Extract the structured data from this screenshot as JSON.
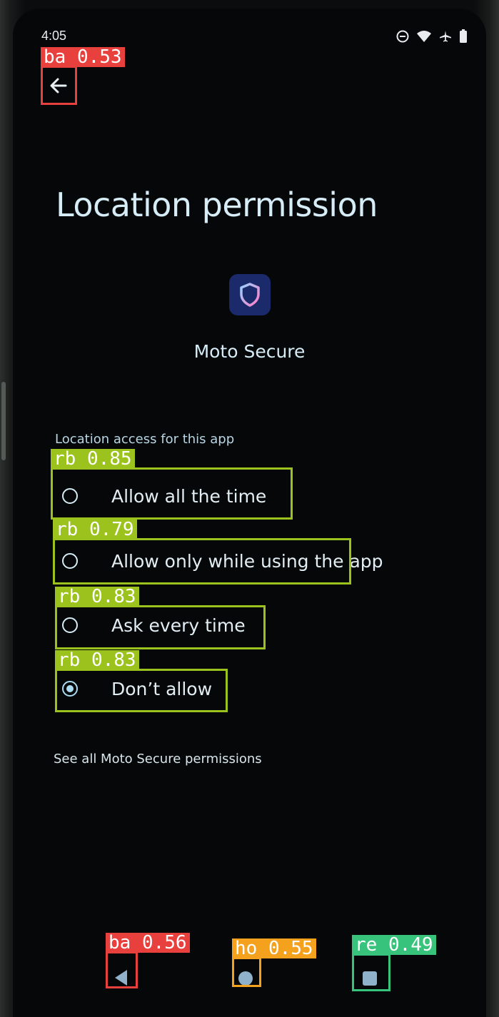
{
  "status_bar": {
    "time": "4:05",
    "icons": [
      "do-not-disturb-icon",
      "wifi-icon",
      "airplane-icon",
      "battery-icon"
    ]
  },
  "page": {
    "title": "Location permission",
    "app_icon": "moto-secure-shield-icon",
    "app_name": "Moto Secure",
    "section_label": "Location access for this app",
    "options": [
      {
        "label": "Allow all the time",
        "checked": false
      },
      {
        "label": "Allow only while using the app",
        "checked": false
      },
      {
        "label": "Ask every time",
        "checked": false
      },
      {
        "label": "Don’t allow",
        "checked": true
      }
    ],
    "see_all_link": "See all Moto Secure permissions"
  },
  "nav_bar": {
    "icons": [
      "back-triangle-icon",
      "home-circle-icon",
      "recents-square-icon"
    ]
  },
  "annotations": [
    {
      "label": "ba 0.53"
    },
    {
      "label": "rb 0.85"
    },
    {
      "label": "rb 0.79"
    },
    {
      "label": "rb 0.83"
    },
    {
      "label": "rb 0.83"
    },
    {
      "label": "ba 0.56"
    },
    {
      "label": "ho 0.55"
    },
    {
      "label": "re 0.49"
    }
  ],
  "colors": {
    "background": "#050709",
    "text_primary": "#d6ecf6",
    "radio_selected": "#a9dcf2",
    "app_icon_bg": "#1b2a6b",
    "annotation_red": "#e8403c",
    "annotation_green": "#9bc21d",
    "annotation_orange": "#f4a21e",
    "annotation_teal": "#38c37d"
  }
}
